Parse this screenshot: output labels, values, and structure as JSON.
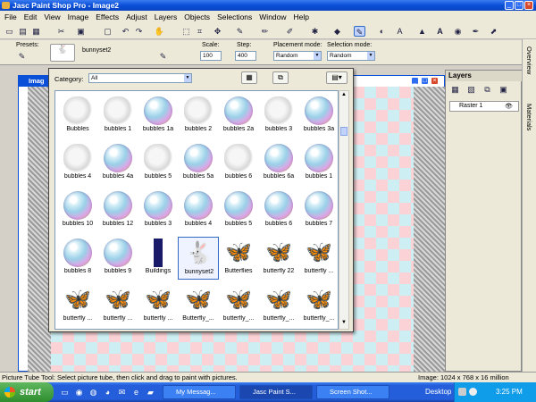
{
  "window": {
    "title": "Jasc Paint Shop Pro - Image2"
  },
  "menu": [
    "File",
    "Edit",
    "View",
    "Image",
    "Effects",
    "Adjust",
    "Layers",
    "Objects",
    "Selections",
    "Window",
    "Help"
  ],
  "tool_options": {
    "presets_label": "Presets:",
    "tube_name": "bunnyset2",
    "scale_label": "Scale:",
    "scale_value": "100",
    "step_label": "Step:",
    "step_value": "400",
    "placement_label": "Placement mode:",
    "placement_value": "Random",
    "selection_label": "Selection mode:",
    "selection_value": "Random"
  },
  "document": {
    "title": "Imag"
  },
  "picker": {
    "category_label": "Category:",
    "category_value": "All",
    "rows": [
      [
        {
          "cap": "Bubbles",
          "k": "cloud"
        },
        {
          "cap": "bubbles 1",
          "k": "cloud"
        },
        {
          "cap": "bubbles 1a",
          "k": "bubble"
        },
        {
          "cap": "bubbles 2",
          "k": "cloud"
        },
        {
          "cap": "bubbles 2a",
          "k": "bubble"
        },
        {
          "cap": "bubbles 3",
          "k": "cloud"
        },
        {
          "cap": "bubbles 3a",
          "k": "bubble"
        }
      ],
      [
        {
          "cap": "bubbles 4",
          "k": "cloud"
        },
        {
          "cap": "bubbles 4a",
          "k": "bubble"
        },
        {
          "cap": "bubbles 5",
          "k": "cloud"
        },
        {
          "cap": "bubbles 5a",
          "k": "bubble"
        },
        {
          "cap": "bubbles 6",
          "k": "cloud"
        },
        {
          "cap": "bubbles 6a",
          "k": "bubble"
        },
        {
          "cap": "bubbles 1",
          "k": "bubble"
        }
      ],
      [
        {
          "cap": "bubbles 10",
          "k": "bubble"
        },
        {
          "cap": "bubbles 12",
          "k": "bubble"
        },
        {
          "cap": "bubbles 3",
          "k": "bubble"
        },
        {
          "cap": "bubbles 4",
          "k": "bubble"
        },
        {
          "cap": "bubbles 5",
          "k": "bubble"
        },
        {
          "cap": "bubbles 6",
          "k": "bubble"
        },
        {
          "cap": "bubbles 7",
          "k": "bubble"
        }
      ],
      [
        {
          "cap": "bubbles 8",
          "k": "bubble"
        },
        {
          "cap": "bubbles 9",
          "k": "bubble"
        },
        {
          "cap": "Buildings",
          "k": "building"
        },
        {
          "cap": "bunnyset2",
          "k": "bunny"
        },
        {
          "cap": "Butterflies",
          "k": "bfly"
        },
        {
          "cap": "butterfly 22",
          "k": "bfly"
        },
        {
          "cap": "butterfly ...",
          "k": "bfly"
        }
      ],
      [
        {
          "cap": "butterfly ...",
          "k": "bfly"
        },
        {
          "cap": "butterfly ...",
          "k": "bfly"
        },
        {
          "cap": "butterfly ...",
          "k": "bfly"
        },
        {
          "cap": "Butterfly_...",
          "k": "bfly"
        },
        {
          "cap": "butterfly_...",
          "k": "bfly"
        },
        {
          "cap": "butterfly_...",
          "k": "bfly"
        },
        {
          "cap": "butterfly_...",
          "k": "bfly"
        }
      ]
    ]
  },
  "layers": {
    "title": "Layers",
    "layer_name": "Raster 1"
  },
  "side_tabs": [
    "Overview",
    "Materials"
  ],
  "status": {
    "left": "Picture Tube Tool: Select picture tube, then click and drag to paint with pictures.",
    "right": "Image:  1024 x 768 x 16 million"
  },
  "taskbar": {
    "start": "start",
    "buttons": [
      "My Messag...",
      "Jasc Paint S...",
      "Screen Shot..."
    ],
    "desktop_label": "Desktop",
    "clock": "3:25 PM"
  }
}
